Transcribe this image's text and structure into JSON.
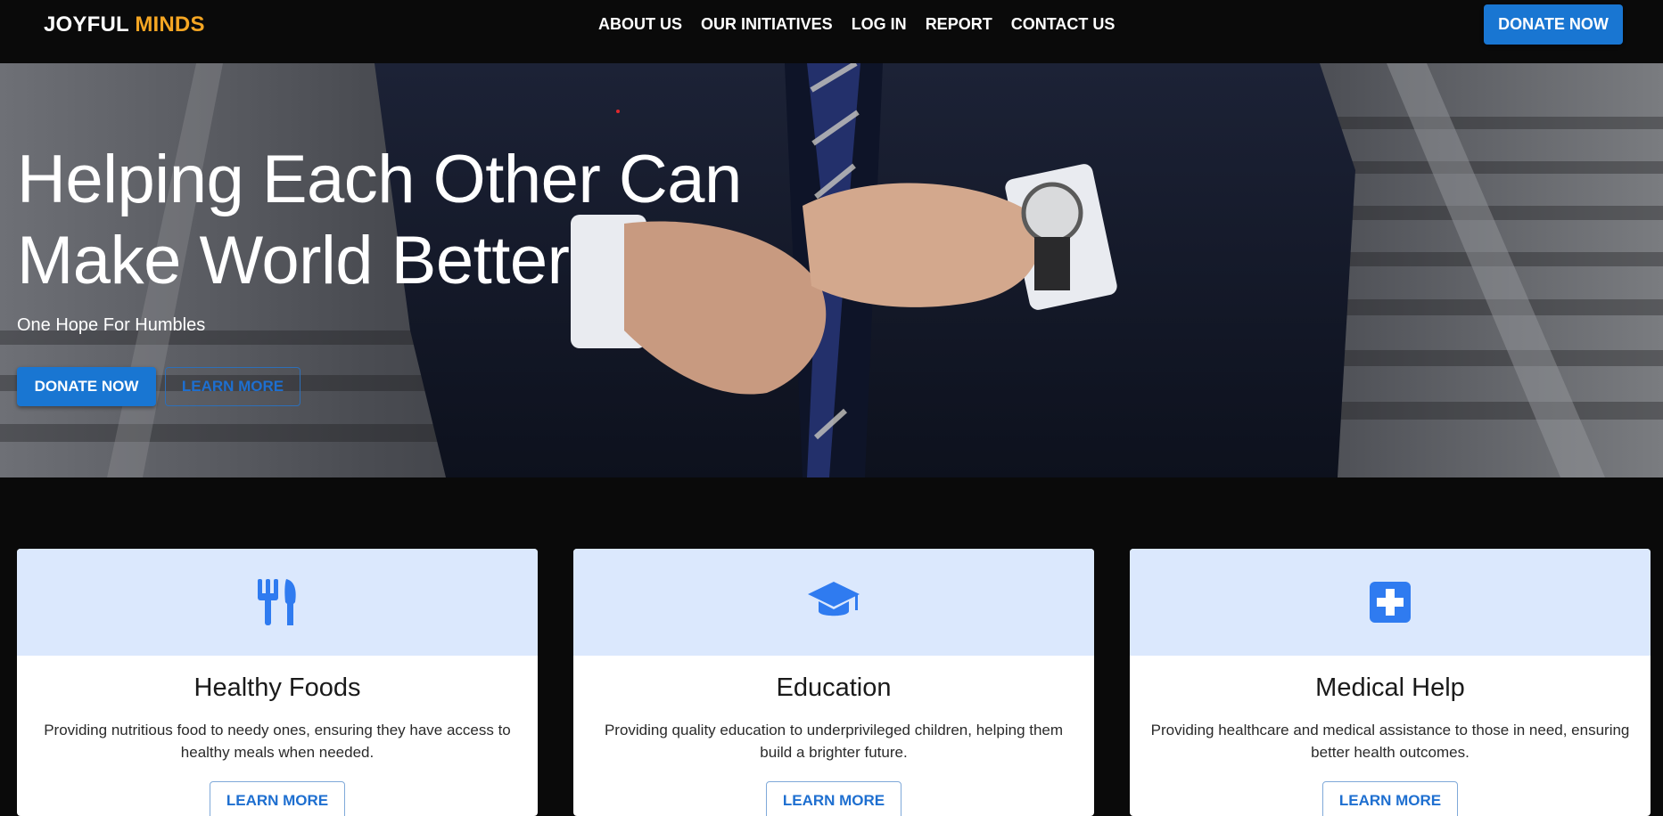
{
  "brand": {
    "part1": "JOYFUL",
    "part2": "MINDS"
  },
  "nav": {
    "links": [
      "ABOUT US",
      "OUR INITIATIVES",
      "LOG IN",
      "REPORT",
      "CONTACT US"
    ],
    "donate_label": "DONATE NOW"
  },
  "hero": {
    "title_line1": "Helping Each Other Can",
    "title_line2": "Make World Better",
    "subtitle": "One Hope For Humbles",
    "donate_label": "DONATE NOW",
    "learn_label": "LEARN MORE"
  },
  "cards": [
    {
      "icon": "utensils-icon",
      "title": "Healthy Foods",
      "text": "Providing nutritious food to needy ones, ensuring they have access to healthy meals when needed.",
      "button": "LEARN MORE"
    },
    {
      "icon": "graduation-cap-icon",
      "title": "Education",
      "text": "Providing quality education to underprivileged children, helping them build a brighter future.",
      "button": "LEARN MORE"
    },
    {
      "icon": "medical-cross-icon",
      "title": "Medical Help",
      "text": "Providing healthcare and medical assistance to those in need, ensuring better health outcomes.",
      "button": "LEARN MORE"
    }
  ],
  "colors": {
    "accent": "#1976d2",
    "brand_highlight": "#f5a623",
    "card_header_bg": "#dbe8fd",
    "icon_blue": "#2f7bf0"
  }
}
